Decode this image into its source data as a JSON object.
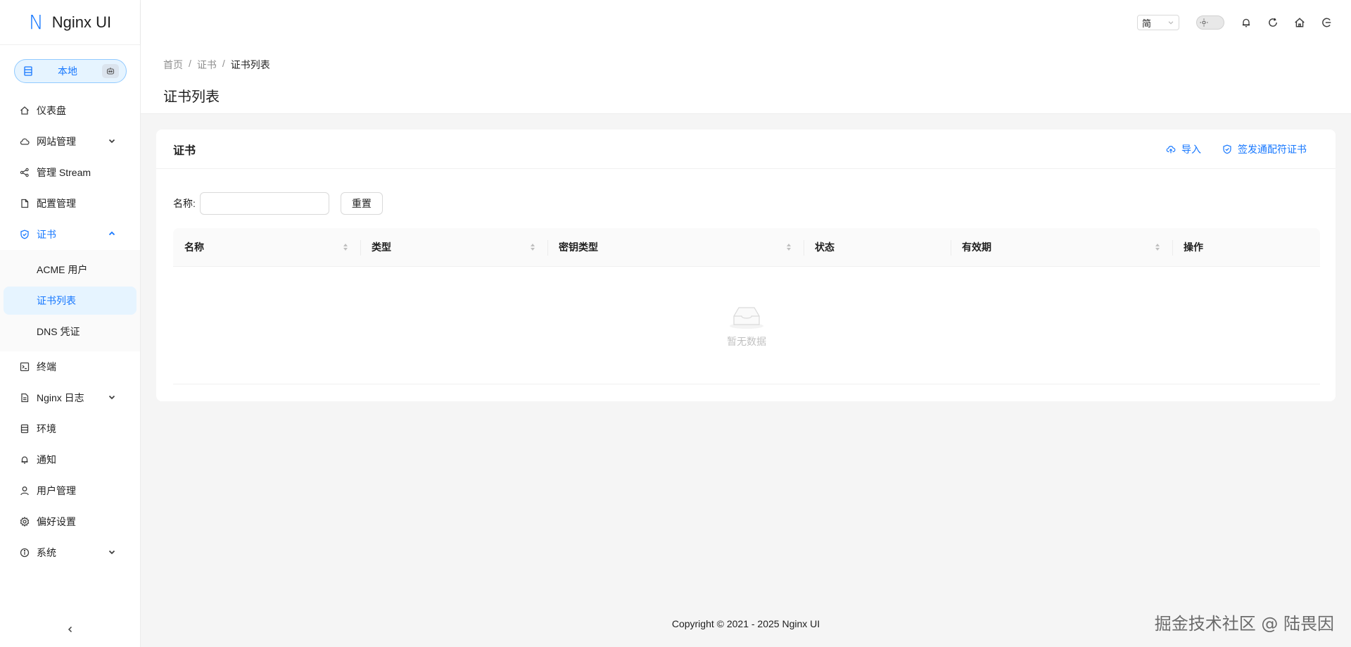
{
  "app": {
    "logo_mark": "N",
    "name": "Nginx UI"
  },
  "env": {
    "label": "本地"
  },
  "sidebar": {
    "items_top": [
      {
        "label": "仪表盘",
        "icon": "home-icon"
      },
      {
        "label": "网站管理",
        "icon": "cloud-icon",
        "expandable": true
      },
      {
        "label": "管理 Stream",
        "icon": "share-icon"
      },
      {
        "label": "配置管理",
        "icon": "file-icon"
      },
      {
        "label": "证书",
        "icon": "shield-icon",
        "expanded": true
      }
    ],
    "cert_sub": [
      {
        "label": "ACME 用户"
      },
      {
        "label": "证书列表",
        "selected": true
      },
      {
        "label": "DNS 凭证"
      }
    ],
    "items_bottom": [
      {
        "label": "终端",
        "icon": "terminal-icon"
      },
      {
        "label": "Nginx 日志",
        "icon": "log-file-icon",
        "expandable": true
      },
      {
        "label": "环境",
        "icon": "database-icon"
      },
      {
        "label": "通知",
        "icon": "bell-icon"
      },
      {
        "label": "用户管理",
        "icon": "user-icon"
      },
      {
        "label": "偏好设置",
        "icon": "settings-icon"
      },
      {
        "label": "系统",
        "icon": "info-icon",
        "expandable": true
      }
    ]
  },
  "header": {
    "language": "简"
  },
  "breadcrumb": [
    "首页",
    "证书",
    "证书列表"
  ],
  "page_title": "证书列表",
  "card": {
    "title": "证书",
    "import_label": "导入",
    "issue_label": "签发通配符证书"
  },
  "filter": {
    "name_label": "名称:",
    "name_value": "",
    "reset_label": "重置"
  },
  "table": {
    "columns": [
      {
        "label": "名称",
        "sortable": true
      },
      {
        "label": "类型",
        "sortable": true
      },
      {
        "label": "密钥类型",
        "sortable": true
      },
      {
        "label": "状态",
        "sortable": false
      },
      {
        "label": "有效期",
        "sortable": true
      },
      {
        "label": "操作",
        "sortable": false
      }
    ],
    "empty_text": "暂无数据"
  },
  "footer": "Copyright © 2021 - 2025 Nginx UI",
  "watermark": "掘金技术社区 @ 陆畏因",
  "colors": {
    "primary": "#1677ff",
    "selected_bg": "#e6f4ff",
    "page_bg": "#f5f5f5"
  }
}
